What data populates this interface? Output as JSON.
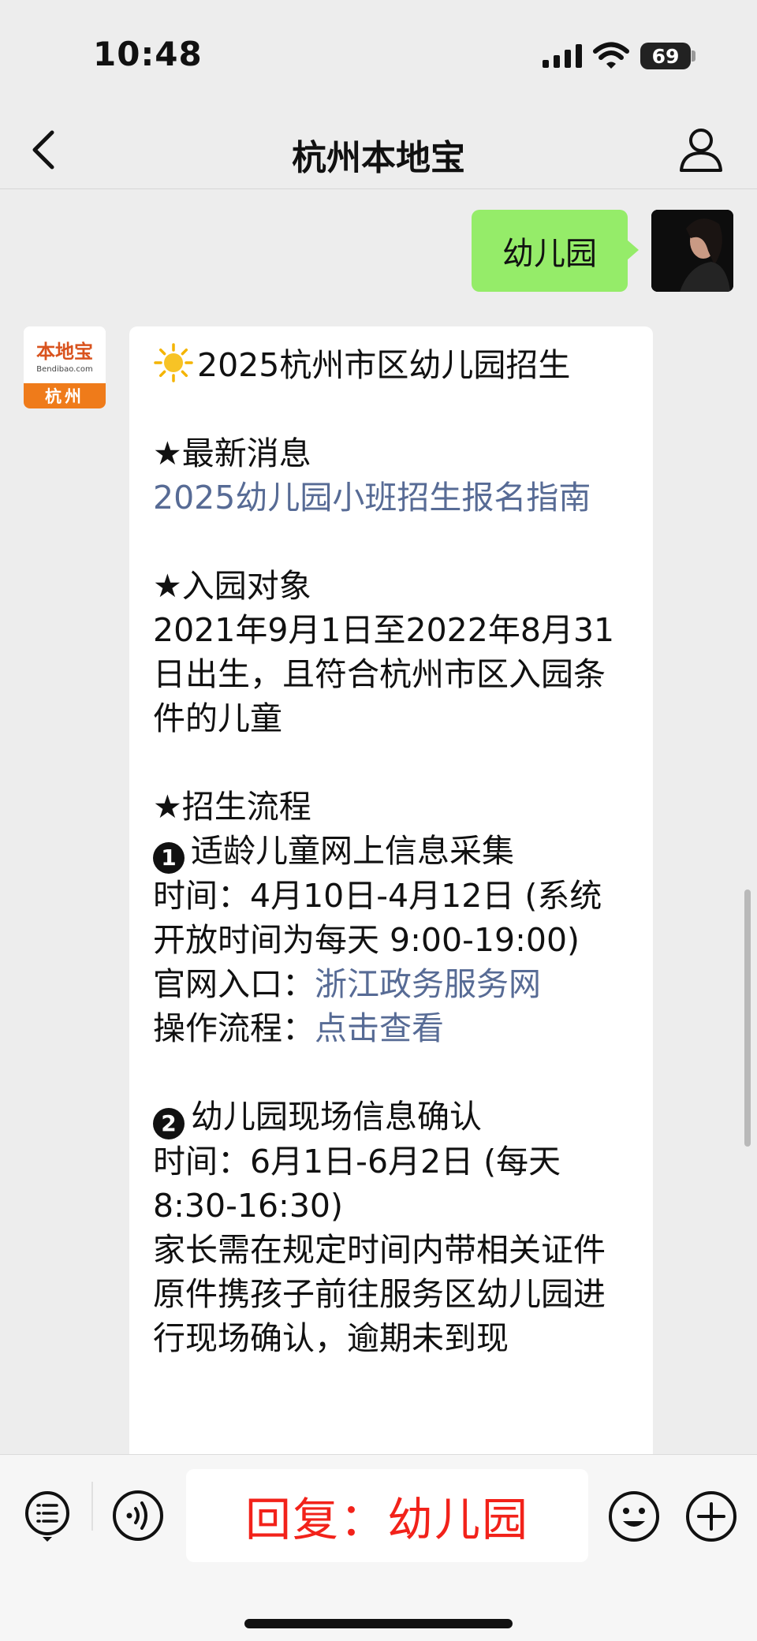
{
  "status_bar": {
    "time": "10:48",
    "battery": "69",
    "icons": [
      "signal-icon",
      "wifi-icon",
      "battery-icon"
    ]
  },
  "nav": {
    "title": "杭州本地宝",
    "icons": [
      "back-icon",
      "user-icon"
    ]
  },
  "messages": {
    "sent": {
      "text": "幼儿园"
    },
    "received": {
      "avatar": {
        "brand": "本地宝",
        "domain": "Bendibao.com",
        "city": "杭州"
      },
      "title": "2025杭州市区幼儿园招生",
      "latest_heading": "★最新消息",
      "latest_link": "2025幼儿园小班招生报名指南",
      "target_heading": "★入园对象",
      "target_text": "2021年9月1日至2022年8月31日出生，且符合杭州市区入园条件的儿童",
      "process_heading": "★招生流程",
      "step1_num": "1",
      "step1_title": "适龄儿童网上信息采集",
      "step1_time": "时间：4月10日-4月12日 (系统开放时间为每天 9:00-19:00)",
      "step1_site_label": "官网入口：",
      "step1_site_link": "浙江政务服务网",
      "step1_ops_label": "操作流程：",
      "step1_ops_link": "点击查看",
      "step2_num": "2",
      "step2_title": "幼儿园现场信息确认",
      "step2_time": "时间：6月1日-6月2日 (每天 8:30-16:30)",
      "step2_text": "家长需在规定时间内带相关证件原件携孩子前往服务区幼儿园进行现场确认，逾期未到现"
    }
  },
  "input_bar": {
    "input_text": "回复：幼儿园",
    "icons": [
      "menu-icon",
      "voice-icon",
      "emoji-icon",
      "plus-icon"
    ]
  },
  "colors": {
    "background": "#ededed",
    "sent_bubble": "#95ec69",
    "link": "#576b95",
    "input_text": "#f2221a",
    "avatar_orange": "#ef7b1a"
  }
}
